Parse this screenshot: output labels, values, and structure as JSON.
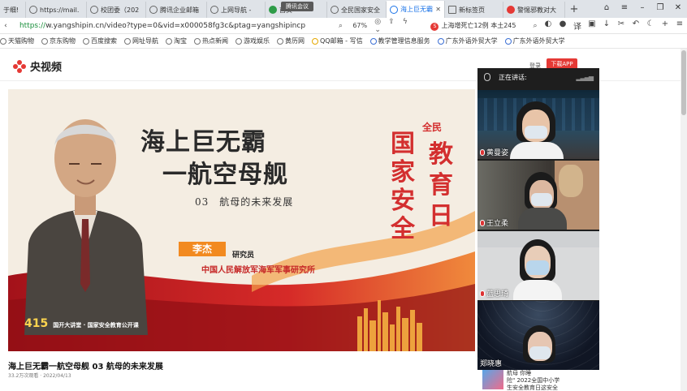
{
  "tabs": [
    {
      "label": "于细!",
      "icon": "doc"
    },
    {
      "label": "https://mail.",
      "icon": "globe"
    },
    {
      "label": "校团委（202",
      "icon": "globe"
    },
    {
      "label": "腾讯企业邮箱",
      "icon": "mail"
    },
    {
      "label": "上网导航 - ",
      "icon": "globe"
    },
    {
      "label": "首页",
      "icon": "green"
    },
    {
      "label": "全民国家安全",
      "icon": "globe"
    },
    {
      "label": "海上巨无霸",
      "icon": "globe",
      "active": true
    },
    {
      "label": "新标签页",
      "icon": "grid"
    },
    {
      "label": "警惕邪教对大",
      "icon": "red"
    }
  ],
  "meeting_pill": "腾讯会议",
  "address": {
    "protocol": "https://",
    "rest": "w.yangshipin.cn/video?type=0&vid=x000058fg3c&ptag=yangshipincp",
    "zoom": "67%",
    "search_text": "上海增死亡12例 本土245"
  },
  "bookmarks": [
    "天猫购物",
    "京东购物",
    "百度搜索",
    "网址导航",
    "淘宝",
    "热点新闻",
    "游戏娱乐",
    "黄历网",
    "QQ邮箱 - 写信",
    "教学管理信息服务",
    "广东外语外贸大学",
    "广东外语外贸大学"
  ],
  "site": {
    "logo_text": "央视频",
    "header_link": "登录",
    "download_button": "下载APP"
  },
  "video": {
    "title_line1": "海上巨无霸",
    "title_line2": "一航空母舰",
    "subtitle": "03　航母的未来发展",
    "speaker_name": "李杰",
    "speaker_role": "研究员",
    "speaker_org": "中国人民解放军海军军事研究所",
    "vertical_col1": "国家安全",
    "vertical_col2": "教育日",
    "vertical_small": "全民",
    "bottom_code": "415",
    "bottom_text": "国开大讲堂 · 国家安全教育公开课"
  },
  "page": {
    "title": "海上巨无霸一航空母舰 03 航母的未来发展",
    "meta": "33.2万次观看 · 2022/04/13"
  },
  "meeting": {
    "header": "正在讲话:",
    "participants": [
      {
        "name": "黄曼姿"
      },
      {
        "name": "王立柔"
      },
      {
        "name": "蓝思琦"
      },
      {
        "name": "郑晓惠"
      }
    ]
  },
  "ad": {
    "line1": "航母 你睡",
    "line2": "险\" 2022全国中小学",
    "line3": "生安全教育日这安全"
  },
  "colors": {
    "accent": "#1a73e8",
    "brand_red": "#e53935",
    "poster_red": "#d32f2f"
  }
}
